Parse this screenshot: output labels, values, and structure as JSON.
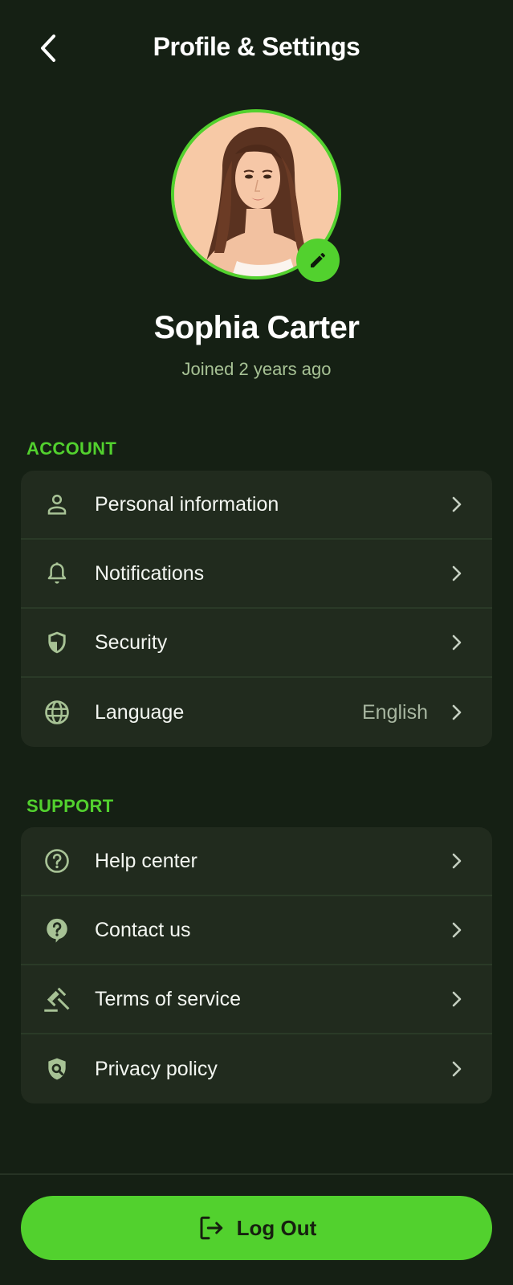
{
  "header": {
    "title": "Profile & Settings",
    "back_icon": "chevron-left-icon"
  },
  "profile": {
    "name": "Sophia Carter",
    "joined": "Joined 2 years ago",
    "edit_icon": "pencil-icon"
  },
  "account": {
    "label": "ACCOUNT",
    "items": [
      {
        "label": "Personal information",
        "icon": "person-icon"
      },
      {
        "label": "Notifications",
        "icon": "bell-icon"
      },
      {
        "label": "Security",
        "icon": "shield-icon"
      },
      {
        "label": "Language",
        "icon": "globe-icon",
        "value": "English"
      }
    ]
  },
  "support": {
    "label": "SUPPORT",
    "items": [
      {
        "label": "Help center",
        "icon": "help-circle-icon"
      },
      {
        "label": "Contact us",
        "icon": "question-bubble-icon"
      },
      {
        "label": "Terms of service",
        "icon": "gavel-icon"
      },
      {
        "label": "Privacy policy",
        "icon": "shield-search-icon"
      }
    ]
  },
  "logout": {
    "label": "Log Out",
    "icon": "logout-icon"
  },
  "colors": {
    "background": "#152014",
    "accent": "#52d12e",
    "card": "#212b1e",
    "muted": "#a7c295"
  }
}
